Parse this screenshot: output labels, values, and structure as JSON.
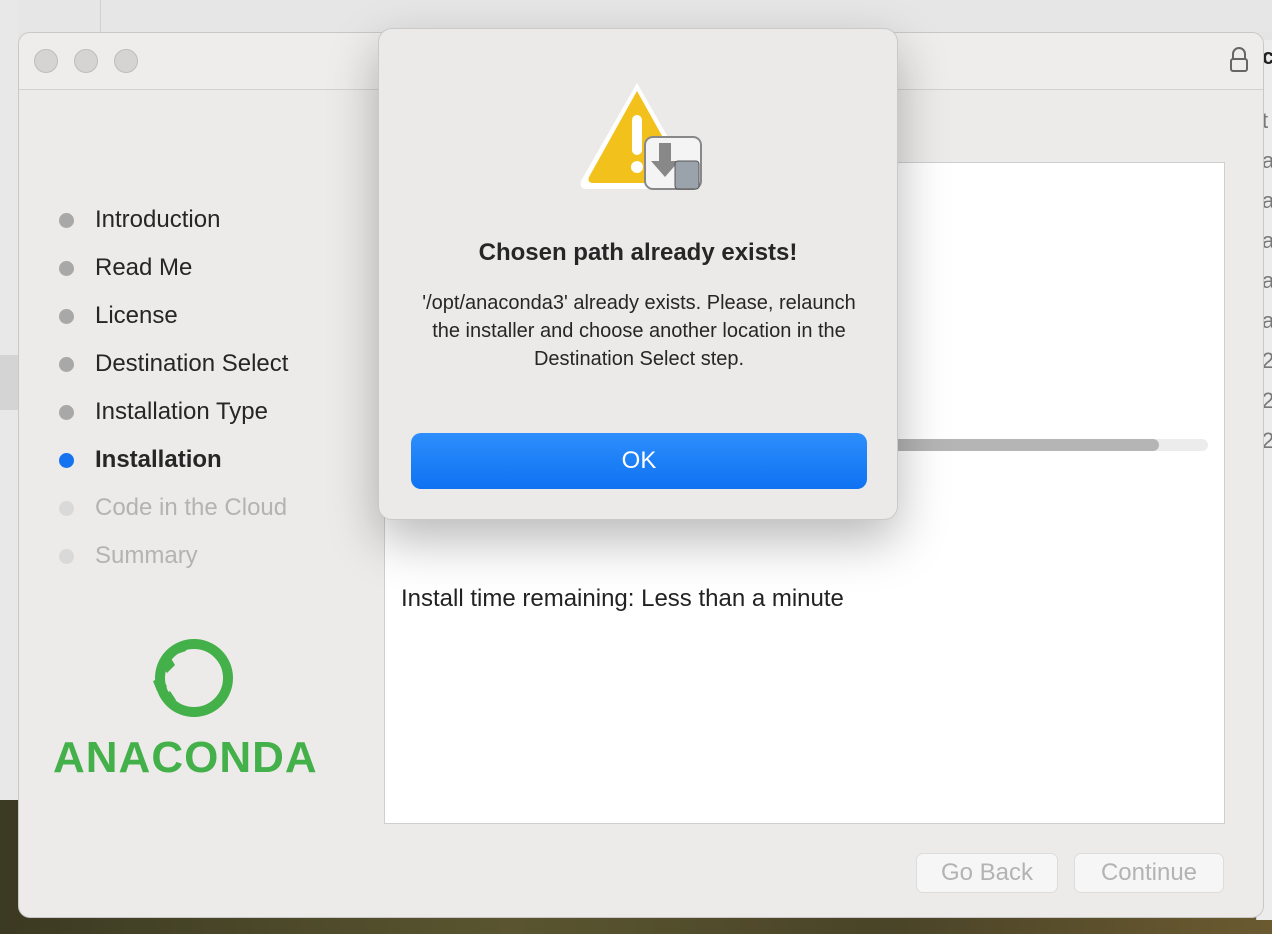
{
  "background": {
    "right_edge_fragments": [
      "c",
      "t",
      "a",
      "a",
      "a",
      "a",
      "a",
      "2",
      "2",
      "2"
    ]
  },
  "steps": [
    {
      "label": "Introduction",
      "state": "done"
    },
    {
      "label": "Read Me",
      "state": "done"
    },
    {
      "label": "License",
      "state": "done"
    },
    {
      "label": "Destination Select",
      "state": "done"
    },
    {
      "label": "Installation Type",
      "state": "done"
    },
    {
      "label": "Installation",
      "state": "active"
    },
    {
      "label": "Code in the Cloud",
      "state": "future"
    },
    {
      "label": "Summary",
      "state": "future"
    }
  ],
  "logo": {
    "text": "ANACONDA",
    "color": "#43b049"
  },
  "content": {
    "progress_percent": 85,
    "time_remaining": "Install time remaining: Less than a minute"
  },
  "buttons": {
    "go_back": "Go Back",
    "continue": "Continue"
  },
  "dialog": {
    "icon": "warning-with-disk-icon",
    "title": "Chosen path already exists!",
    "message": "'/opt/anaconda3' already exists. Please, relaunch the installer and choose another location in the Destination Select step.",
    "ok": "OK"
  },
  "colors": {
    "accent": "#1673f0",
    "warning": "#f2c11b"
  }
}
